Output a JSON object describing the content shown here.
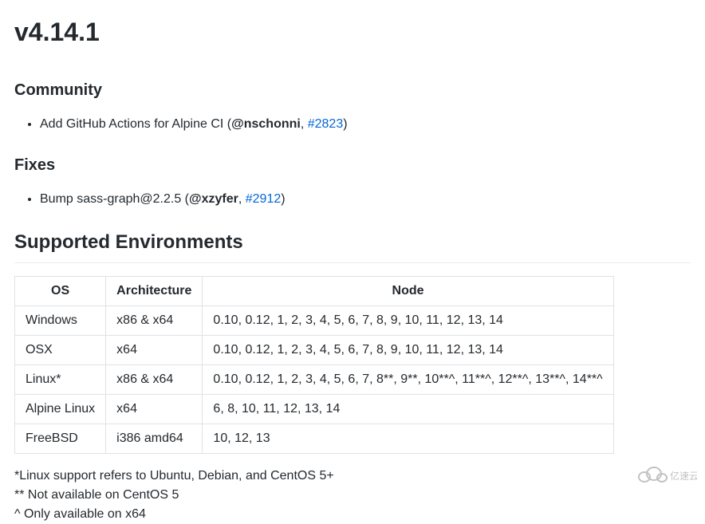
{
  "title": "v4.14.1",
  "sections": {
    "community": {
      "heading": "Community",
      "item_prefix": "Add GitHub Actions for Alpine CI (",
      "author": "@nschonni",
      "sep": ", ",
      "issue": "#2823",
      "suffix": ")"
    },
    "fixes": {
      "heading": "Fixes",
      "item_prefix": "Bump sass-graph@2.2.5 (",
      "author": "@xzyfer",
      "sep": ", ",
      "issue": "#2912",
      "suffix": ")"
    }
  },
  "env": {
    "heading": "Supported Environments",
    "headers": {
      "os": "OS",
      "arch": "Architecture",
      "node": "Node"
    },
    "rows": [
      {
        "os": "Windows",
        "arch": "x86 & x64",
        "node": "0.10, 0.12, 1, 2, 3, 4, 5, 6, 7, 8, 9, 10, 11, 12, 13, 14"
      },
      {
        "os": "OSX",
        "arch": "x64",
        "node": "0.10, 0.12, 1, 2, 3, 4, 5, 6, 7, 8, 9, 10, 11, 12, 13, 14"
      },
      {
        "os": "Linux*",
        "arch": "x86 & x64",
        "node": "0.10, 0.12, 1, 2, 3, 4, 5, 6, 7, 8**, 9**, 10**^, 11**^, 12**^, 13**^, 14**^"
      },
      {
        "os": "Alpine Linux",
        "arch": "x64",
        "node": "6, 8, 10, 11, 12, 13, 14"
      },
      {
        "os": "FreeBSD",
        "arch": "i386 amd64",
        "node": "10, 12, 13"
      }
    ]
  },
  "footnotes": {
    "n1": "*Linux support refers to Ubuntu, Debian, and CentOS 5+",
    "n2": "** Not available on CentOS 5",
    "n3": "^ Only available on x64"
  },
  "watermark": "亿速云"
}
